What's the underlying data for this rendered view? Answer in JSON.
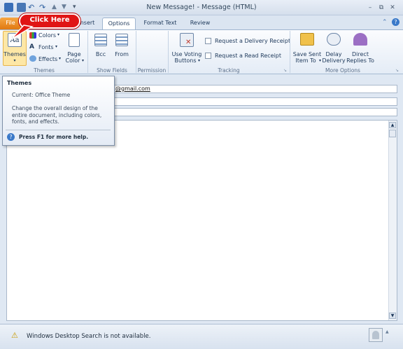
{
  "window": {
    "title": "New Message! - Message (HTML)",
    "controls": {
      "minimize": "–",
      "restore": "⧉",
      "close": "✕"
    }
  },
  "quick_access": {
    "save": "save-icon",
    "undo": "↶",
    "redo": "↷",
    "customize": "▾"
  },
  "tabs": [
    {
      "label": "File"
    },
    {
      "label": "nsert"
    },
    {
      "label": "Options"
    },
    {
      "label": "Format Text"
    },
    {
      "label": "Review"
    }
  ],
  "callout": {
    "text": "Click Here"
  },
  "ribbon": {
    "themes_group": {
      "themes_label": "Themes",
      "colors_label": "Colors",
      "fonts_label": "Fonts",
      "effects_label": "Effects",
      "page_color_line1": "Page",
      "page_color_line2": "Color",
      "group_label": "Themes"
    },
    "show_fields": {
      "bcc": "Bcc",
      "from": "From",
      "group_label": "Show Fields"
    },
    "permission": {
      "group_label": "Permission"
    },
    "tracking": {
      "voting_line1": "Use Voting",
      "voting_line2": "Buttons",
      "delivery_receipt": "Request a Delivery Receipt",
      "read_receipt": "Request a Read Receipt",
      "group_label": "Tracking"
    },
    "more_options": {
      "save_sent_line1": "Save Sent",
      "save_sent_line2": "Item To",
      "delay_line1": "Delay",
      "delay_line2": "Delivery",
      "direct_line1": "Direct",
      "direct_line2": "Replies To",
      "group_label": "More Options"
    }
  },
  "compose": {
    "to_value": "@gmail.com"
  },
  "tooltip": {
    "title": "Themes",
    "current": "Current: Office Theme",
    "description": "Change the overall design of the entire document, including colors, fonts, and effects.",
    "help": "Press F1 for more help."
  },
  "status": {
    "message": "Windows Desktop Search is not available."
  },
  "colors": {
    "file_tab": "#e07810",
    "callout": "#e01515",
    "ribbon_bg": "#e4ecf6"
  }
}
